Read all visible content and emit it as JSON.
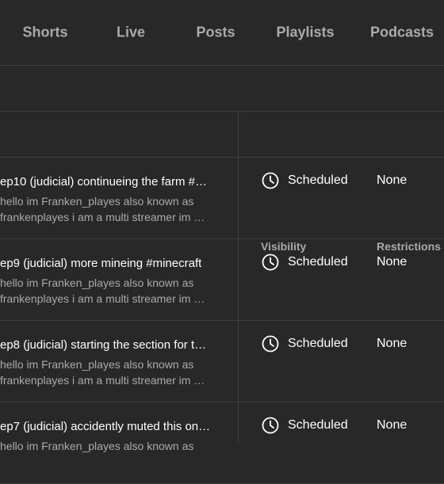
{
  "tabs": [
    "Shorts",
    "Live",
    "Posts",
    "Playlists",
    "Podcasts"
  ],
  "table": {
    "headers": {
      "visibility": "Visibility",
      "restrictions": "Restrictions"
    },
    "rows": [
      {
        "title": "ep10 (judicial) continueing the farm #…",
        "desc_line1": "hello im Franken_playes also known as",
        "desc_line2": "frankenplayes i am a multi streamer im …",
        "visibility": "Scheduled",
        "visibility_icon": "clock-icon",
        "restrictions": "None"
      },
      {
        "title": "ep9 (judicial) more mineing #minecraft",
        "desc_line1": "hello im Franken_playes also known as",
        "desc_line2": "frankenplayes i am a multi streamer im …",
        "visibility": "Scheduled",
        "visibility_icon": "clock-icon",
        "restrictions": "None"
      },
      {
        "title": "ep8 (judicial) starting the section for t…",
        "desc_line1": "hello im Franken_playes also known as",
        "desc_line2": "frankenplayes i am a multi streamer im …",
        "visibility": "Scheduled",
        "visibility_icon": "clock-icon",
        "restrictions": "None"
      },
      {
        "title": "ep7 (judicial) accidently muted this on…",
        "desc_line1": "hello im Franken_playes also known as",
        "desc_line2": "",
        "visibility": "Scheduled",
        "visibility_icon": "clock-icon",
        "restrictions": "None"
      }
    ]
  },
  "colors": {
    "background": "#282828",
    "divider": "#3e3e3e",
    "muted_text": "#aaaaaa",
    "text": "#ffffff"
  }
}
